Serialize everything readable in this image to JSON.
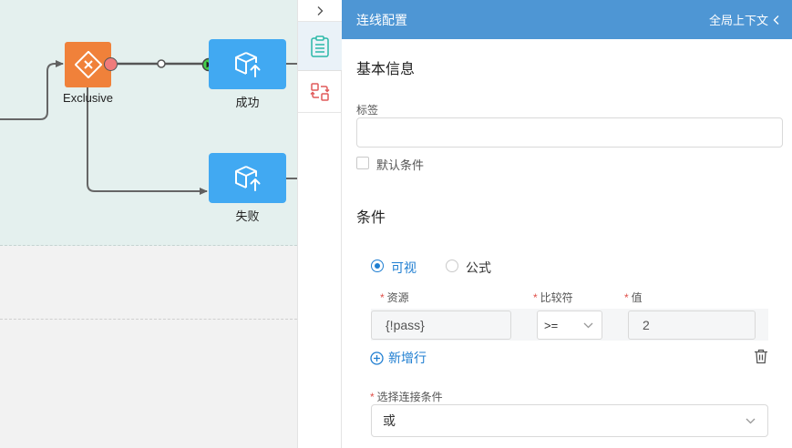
{
  "canvas": {
    "nodes": {
      "exclusive_label": "Exclusive",
      "success_label": "成功",
      "fail_label": "失败"
    }
  },
  "panel": {
    "title": "连线配置",
    "global_context": "全局上下文",
    "basic_info_title": "基本信息",
    "label_field": {
      "label": "标签",
      "value": ""
    },
    "default_condition": {
      "label": "默认条件",
      "checked": false
    },
    "condition_title": "条件",
    "mode": {
      "options": [
        "可视",
        "公式"
      ],
      "selected": "可视"
    },
    "columns": {
      "resource": "资源",
      "comparator": "比较符",
      "value": "值"
    },
    "rows": [
      {
        "resource": "{!pass}",
        "comparator": ">=",
        "value": "2"
      }
    ],
    "add_row_label": "新增行",
    "connection_condition": {
      "label": "选择连接条件",
      "value": "或"
    }
  },
  "colors": {
    "header": "#4e96d4",
    "accent": "#1f7ed1",
    "exclusive_node": "#f0813a",
    "task_node": "#41a9f2",
    "canvas": "#e4f0ee",
    "required": "#e0504a"
  }
}
